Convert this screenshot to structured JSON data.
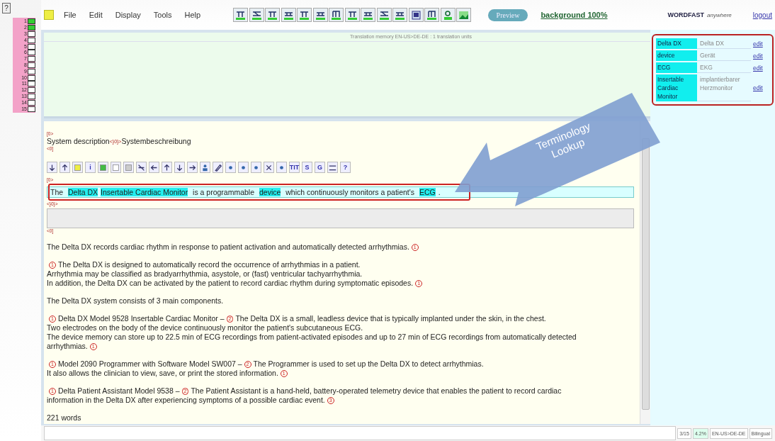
{
  "segment_nav": {
    "help": "?",
    "items": [
      {
        "number": "1",
        "done": true
      },
      {
        "number": "2",
        "done": true
      },
      {
        "number": "3",
        "done": false
      },
      {
        "number": "4",
        "done": false
      },
      {
        "number": "5",
        "done": false
      },
      {
        "number": "6",
        "done": false
      },
      {
        "number": "7",
        "done": false
      },
      {
        "number": "8",
        "done": false
      },
      {
        "number": "9",
        "done": false
      },
      {
        "number": "10",
        "done": false
      },
      {
        "number": "11",
        "done": false
      },
      {
        "number": "12",
        "done": false
      },
      {
        "number": "13",
        "done": false
      },
      {
        "number": "14",
        "done": false
      },
      {
        "number": "15",
        "done": false
      }
    ]
  },
  "menu": [
    "File",
    "Edit",
    "Display",
    "Tools",
    "Help"
  ],
  "preview_button": "Preview",
  "background_link": "background 100%",
  "brand": {
    "name": "WORDFAST",
    "tagline": "anywhere"
  },
  "logout": "logout",
  "tm_panel": {
    "header": "Translation memory EN-US>DE-DE : 1 translation units"
  },
  "editor": {
    "prev_open_tag": "[0>",
    "prev_source": "System description",
    "prev_separator": "<}0}>",
    "prev_target": "Systembeschreibung",
    "prev_close_tag": "<0]",
    "segment_toolbar": [
      {
        "kind": "icon"
      },
      {
        "kind": "icon"
      },
      {
        "kind": "icon"
      },
      {
        "kind": "text",
        "label": "i"
      },
      {
        "kind": "icon"
      },
      {
        "kind": "icon"
      },
      {
        "kind": "icon"
      },
      {
        "kind": "icon"
      },
      {
        "kind": "icon"
      },
      {
        "kind": "icon"
      },
      {
        "kind": "icon"
      },
      {
        "kind": "icon"
      },
      {
        "kind": "icon"
      },
      {
        "kind": "icon"
      },
      {
        "kind": "icon"
      },
      {
        "kind": "icon"
      },
      {
        "kind": "icon"
      },
      {
        "kind": "icon"
      },
      {
        "kind": "icon"
      },
      {
        "kind": "text",
        "label": "TIT"
      },
      {
        "kind": "text",
        "label": "S"
      },
      {
        "kind": "text",
        "label": "G"
      },
      {
        "kind": "icon"
      },
      {
        "kind": "text",
        "label": "?"
      }
    ],
    "active_open_tag": "[0>",
    "active_source": [
      {
        "text": "The ",
        "term": false
      },
      {
        "text": "Delta DX",
        "term": true
      },
      {
        "text": "Insertable Cardiac Monitor",
        "term": true
      },
      {
        "text": " is a programmable ",
        "term": false
      },
      {
        "text": "device",
        "term": true
      },
      {
        "text": " which continuously monitors a patient's ",
        "term": false
      },
      {
        "text": "ECG",
        "term": true
      },
      {
        "text": ".",
        "term": false
      }
    ],
    "target_separator": "<}0}>",
    "close_tag": "<0]",
    "paragraphs": [
      [
        [
          {
            "text": "The Delta DX records cardiac rhythm in response to patient activation and automatically detected arrhythmias.",
            "kind": "text"
          },
          {
            "text": "1",
            "kind": "tag"
          }
        ]
      ],
      [
        [
          {
            "text": "1",
            "kind": "tag"
          },
          {
            "text": "The Delta DX is designed to automatically record the occurrence of arrhythmias in a patient.",
            "kind": "text"
          }
        ],
        [
          {
            "text": "Arrhythmia may be classified as bradyarrhythmia, asystole, or (fast) ventricular tachyarrhythmia.",
            "kind": "text"
          }
        ],
        [
          {
            "text": "In addition, the Delta DX can be activated by the patient to record cardiac rhythm during symptomatic episodes.",
            "kind": "text"
          },
          {
            "text": "1",
            "kind": "tag"
          }
        ]
      ],
      [
        [
          {
            "text": "The Delta DX system consists of 3 main components.",
            "kind": "text"
          }
        ]
      ],
      [
        [
          {
            "text": "1",
            "kind": "tag"
          },
          {
            "text": "Delta DX Model 9528 Insertable Cardiac Monitor –",
            "kind": "text"
          },
          {
            "text": "2",
            "kind": "tag"
          },
          {
            "text": "The Delta DX is a small, leadless device that is typically implanted under the skin, in the chest.",
            "kind": "text"
          }
        ],
        [
          {
            "text": "Two electrodes on the body of the device continuously monitor the patient's subcutaneous ECG.",
            "kind": "text"
          }
        ],
        [
          {
            "text": "The device memory can store up to 22.5 min of ECG recordings from patient-activated episodes and up to 27 min of ECG recordings from automatically detected",
            "kind": "text"
          }
        ],
        [
          {
            "text": "arrhythmias.",
            "kind": "text"
          },
          {
            "text": "1",
            "kind": "tag"
          }
        ]
      ],
      [
        [
          {
            "text": "1",
            "kind": "tag"
          },
          {
            "text": "Model 2090 Programmer with Software Model SW007 –",
            "kind": "text"
          },
          {
            "text": "2",
            "kind": "tag"
          },
          {
            "text": "The Programmer is used to set up the Delta DX to detect arrhythmias.",
            "kind": "text"
          }
        ],
        [
          {
            "text": "It also allows the clinician to view, save, or print the stored information.",
            "kind": "text"
          },
          {
            "text": "1",
            "kind": "tag"
          }
        ]
      ],
      [
        [
          {
            "text": "1",
            "kind": "tag"
          },
          {
            "text": "Delta Patient Assistant Model 9538 –",
            "kind": "text"
          },
          {
            "text": "2",
            "kind": "tag"
          },
          {
            "text": "The Patient Assistant is a hand-held, battery-operated telemetry device that enables the patient to record cardiac",
            "kind": "text"
          }
        ],
        [
          {
            "text": "information in the Delta DX after experiencing symptoms of a possible cardiac event.",
            "kind": "text"
          },
          {
            "text": "3",
            "kind": "tag"
          }
        ]
      ]
    ],
    "word_count": "221 words"
  },
  "callout": {
    "lines": [
      "Terminology",
      "Lookup"
    ]
  },
  "terminology": [
    {
      "source": "Delta DX",
      "target": "Delta DX",
      "action": "edit"
    },
    {
      "source": "device",
      "target": "Gerät",
      "action": "edit"
    },
    {
      "source": "ECG",
      "target": "EKG",
      "action": "edit"
    },
    {
      "source": "Insertable Cardiac Monitor",
      "target": "implantierbarer Herzmonitor",
      "action": "edit"
    }
  ],
  "status_bar": {
    "segment": "3/15",
    "percent": "4.2%",
    "language_pair": "EN-US>DE-DE",
    "mode": "Bilingual"
  }
}
